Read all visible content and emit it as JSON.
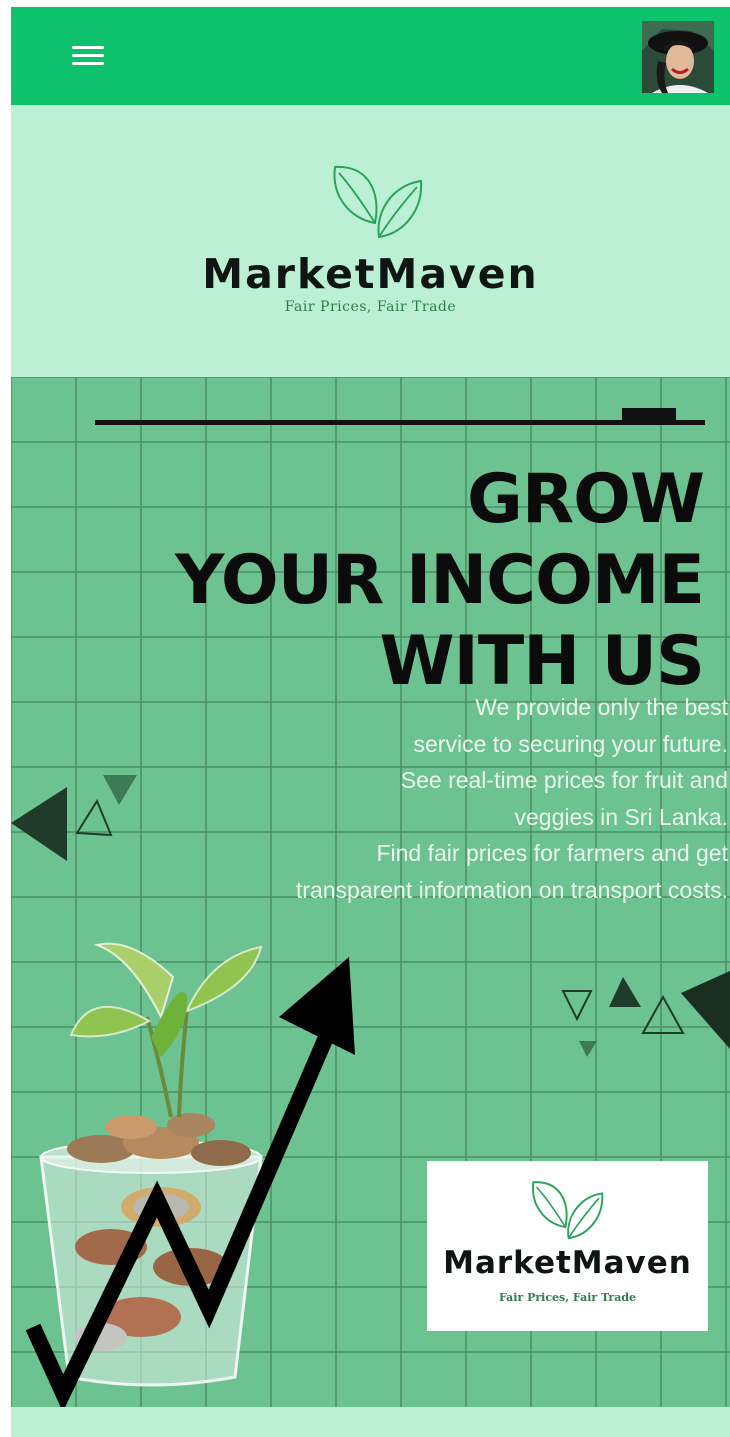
{
  "topbar": {
    "menu_icon": "hamburger-menu-icon",
    "avatar_icon": "user-avatar-photo"
  },
  "brand": {
    "logo_icon": "twin-leaves-icon",
    "name": "MarketMaven",
    "tagline": "Fair Prices, Fair Trade"
  },
  "hero": {
    "headline": [
      "GROW",
      "YOUR INCOME",
      "WITH US"
    ],
    "description": [
      "We provide only the best",
      "service to securing your future.",
      "See real-time prices for fruit and",
      "veggies in Sri Lanka.",
      "Find fair prices for farmers and get",
      "transparent information on transport costs."
    ],
    "illustration": "plant-in-coin-jar-with-rising-arrow",
    "logo_card": {
      "name": "MarketMaven",
      "tagline": "Fair Prices, Fair Trade"
    }
  },
  "colors": {
    "topbar": "#0ec16d",
    "brand_background": "#bbf0d4",
    "hero_background": "#6cc290",
    "headline_text": "#0b0b0b",
    "description_text": "#ebf6ef",
    "tagline_text": "#2f7d4c"
  }
}
